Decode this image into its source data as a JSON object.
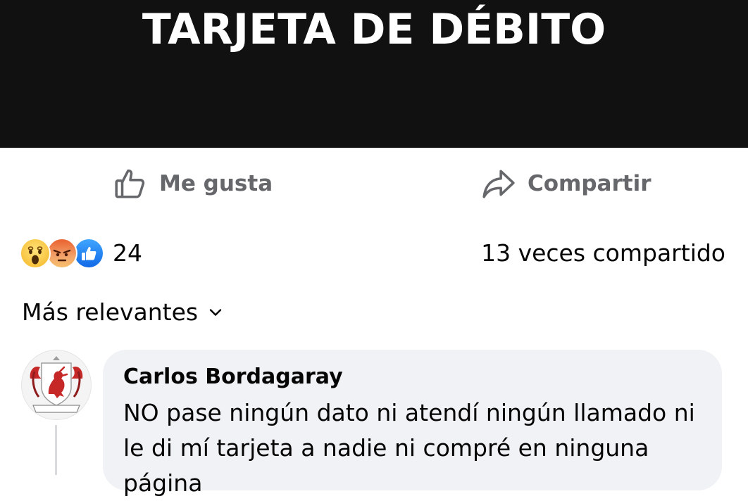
{
  "post": {
    "image_title": "TARJETA DE DÉBITO"
  },
  "actions": {
    "like_label": "Me gusta",
    "share_label": "Compartir"
  },
  "stats": {
    "reactions": [
      "wow",
      "angry",
      "like"
    ],
    "reaction_count": "24",
    "shares_text": "13 veces compartido"
  },
  "comments": {
    "sort_label": "Más relevantes",
    "items": [
      {
        "author": "Carlos Bordagaray",
        "avatar_caption": "Bordagaray",
        "text": "NO pase ningún dato ni atendí ningún llamado ni le di mí tarjeta a nadie ni compré en ninguna página"
      }
    ]
  },
  "colors": {
    "banner_bg": "#111111",
    "muted_text": "#65676b",
    "bubble_bg": "#f0f2f5",
    "like_blue": "#1877f2"
  }
}
